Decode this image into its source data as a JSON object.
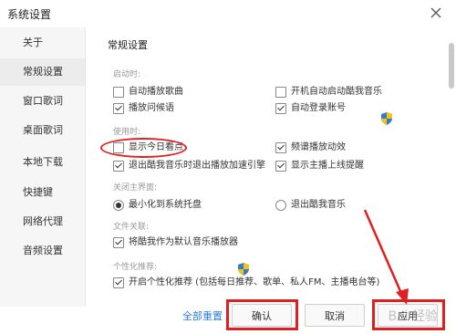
{
  "window": {
    "title": "系统设置"
  },
  "sidebar": {
    "items": [
      {
        "label": "关于",
        "active": false
      },
      {
        "label": "常规设置",
        "active": true
      },
      {
        "label": "窗口歌词",
        "active": false
      },
      {
        "label": "桌面歌词",
        "active": false
      },
      {
        "label": "本地下载",
        "active": false
      },
      {
        "label": "快捷键",
        "active": false
      },
      {
        "label": "网络代理",
        "active": false
      },
      {
        "label": "音频设置",
        "active": false
      }
    ]
  },
  "main": {
    "section_title": "常规设置",
    "groups": {
      "startup": "启动时:",
      "usage": "使用时:",
      "close": "关闭主界面:",
      "file": "文件关联:",
      "personal": "个性化推荐:"
    },
    "options": {
      "auto_play": {
        "label": "自动播放歌曲",
        "checked": false
      },
      "autostart": {
        "label": "开机自动启动酷我音乐",
        "checked": false
      },
      "play_greeting": {
        "label": "播放问候语",
        "checked": true
      },
      "auto_login": {
        "label": "自动登录账号",
        "checked": true
      },
      "today_hot": {
        "label": "显示今日看点",
        "checked": false
      },
      "spectrum": {
        "label": "频谱播放动效",
        "checked": true
      },
      "exit_accel": {
        "label": "退出酷我音乐时退出播放加速引擎",
        "checked": true
      },
      "anchor_notice": {
        "label": "显示主播上线提醒",
        "checked": true
      },
      "minimize_tray": {
        "label": "最小化到系统托盘",
        "checked": true
      },
      "exit_app": {
        "label": "退出酷我音乐",
        "checked": false
      },
      "default_player": {
        "label": "将酷我作为默认音乐播放器",
        "checked": true
      },
      "personal_rec": {
        "label": "开启个性化推荐 (包括每日推荐、歌单、私人FM、主播电台等)",
        "checked": true
      }
    }
  },
  "footer": {
    "reset": "全部重置",
    "confirm": "确认",
    "cancel": "取消",
    "apply": "应用"
  },
  "icons": {
    "close": "close-icon",
    "shield": "uac-shield-icon"
  },
  "colors": {
    "annotation": "#e02020",
    "link": "#2a7de1"
  },
  "watermark": "Bai 经验"
}
